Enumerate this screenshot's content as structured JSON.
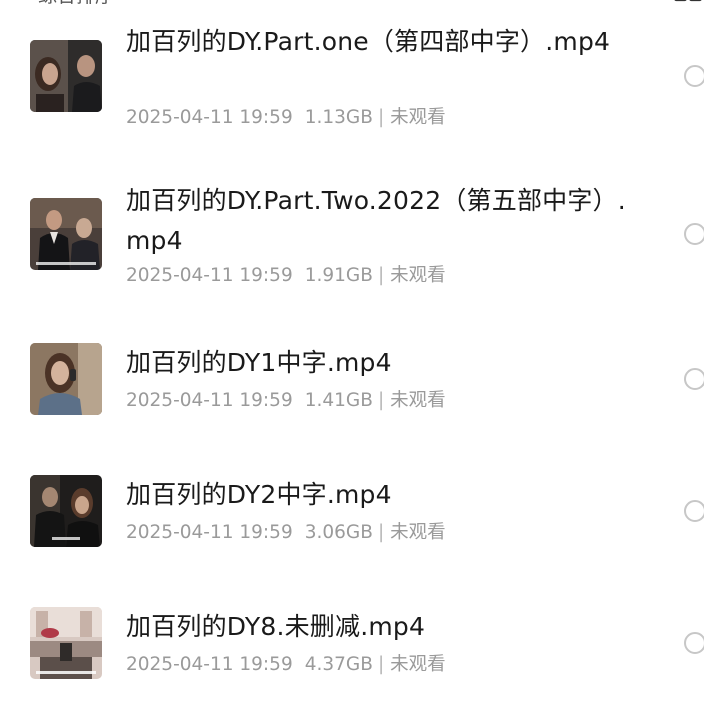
{
  "header": {
    "partial_title": "综合排序"
  },
  "files": [
    {
      "name": "加百列的DY.Part.one（第四部中字）.mp4",
      "date": "2025-04-11 19:59",
      "size": "1.13GB",
      "separator": "|",
      "status": "未观看",
      "thumb_icon": "video-thumbnail-icon"
    },
    {
      "name": "加百列的DY.Part.Two.2022（第五部中字）.mp4",
      "date": "2025-04-11 19:59",
      "size": "1.91GB",
      "separator": "|",
      "status": "未观看",
      "thumb_icon": "video-thumbnail-icon"
    },
    {
      "name": "加百列的DY1中字.mp4",
      "date": "2025-04-11 19:59",
      "size": "1.41GB",
      "separator": "|",
      "status": "未观看",
      "thumb_icon": "video-thumbnail-icon"
    },
    {
      "name": "加百列的DY2中字.mp4",
      "date": "2025-04-11 19:59",
      "size": "3.06GB",
      "separator": "|",
      "status": "未观看",
      "thumb_icon": "video-thumbnail-icon"
    },
    {
      "name": "加百列的DY8.未删减.mp4",
      "date": "2025-04-11 19:59",
      "size": "4.37GB",
      "separator": "|",
      "status": "未观看",
      "thumb_icon": "video-thumbnail-icon"
    }
  ],
  "icons": {
    "view_toggle": "grid-view-icon",
    "select": "select-circle-icon"
  },
  "colors": {
    "title_text": "#1a1a1a",
    "meta_text": "#9a9a9a",
    "circle_border": "#c7c7c7",
    "background": "#ffffff"
  }
}
